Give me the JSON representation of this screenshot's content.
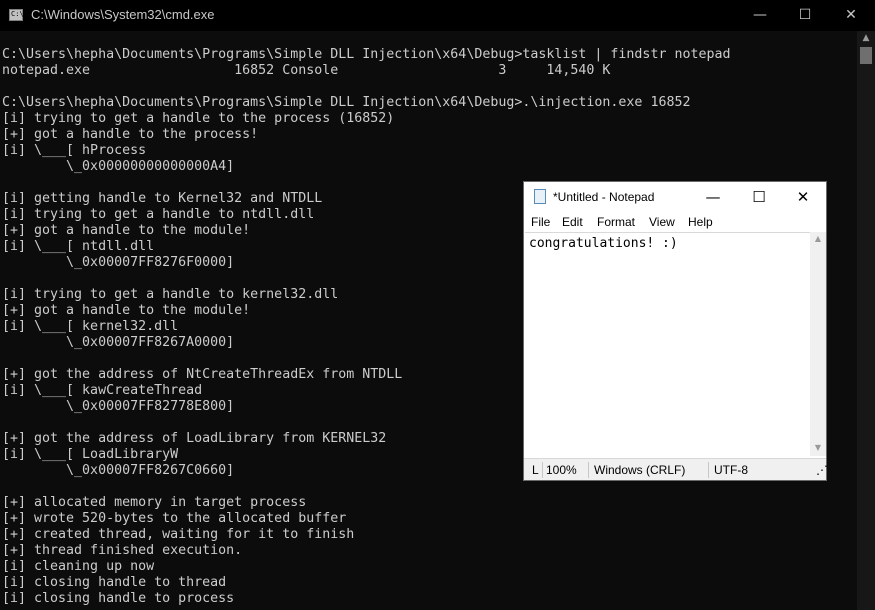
{
  "cmd": {
    "title": "C:\\Windows\\System32\\cmd.exe",
    "min_glyph": "—",
    "max_glyph": "☐",
    "close_glyph": "✕",
    "lines": [
      "C:\\Users\\hepha\\Documents\\Programs\\Simple DLL Injection\\x64\\Debug>tasklist | findstr notepad",
      "notepad.exe                  16852 Console                    3     14,540 K",
      "",
      "C:\\Users\\hepha\\Documents\\Programs\\Simple DLL Injection\\x64\\Debug>.\\injection.exe 16852",
      "[i] trying to get a handle to the process (16852)",
      "[+] got a handle to the process!",
      "[i] \\___[ hProcess",
      "        \\_0x00000000000000A4]",
      "",
      "[i] getting handle to Kernel32 and NTDLL",
      "[i] trying to get a handle to ntdll.dll",
      "[+] got a handle to the module!",
      "[i] \\___[ ntdll.dll",
      "        \\_0x00007FF8276F0000]",
      "",
      "[i] trying to get a handle to kernel32.dll",
      "[+] got a handle to the module!",
      "[i] \\___[ kernel32.dll",
      "        \\_0x00007FF8267A0000]",
      "",
      "[+] got the address of NtCreateThreadEx from NTDLL",
      "[i] \\___[ kawCreateThread",
      "        \\_0x00007FF82778E800]",
      "",
      "[+] got the address of LoadLibrary from KERNEL32",
      "[i] \\___[ LoadLibraryW",
      "        \\_0x00007FF8267C0660]",
      "",
      "[+] allocated memory in target process",
      "[+] wrote 520-bytes to the allocated buffer",
      "[+] created thread, waiting for it to finish",
      "[+] thread finished execution.",
      "[i] cleaning up now",
      "[i] closing handle to thread",
      "[i] closing handle to process"
    ]
  },
  "notepad": {
    "title": "*Untitled - Notepad",
    "min_glyph": "—",
    "max_glyph": "☐",
    "close_glyph": "✕",
    "menu": [
      "File",
      "Edit",
      "Format",
      "View",
      "Help"
    ],
    "content": "congratulations! :)",
    "status": {
      "position": "L",
      "zoom": "100%",
      "line_ending": "Windows (CRLF)",
      "encoding": "UTF-8"
    }
  }
}
